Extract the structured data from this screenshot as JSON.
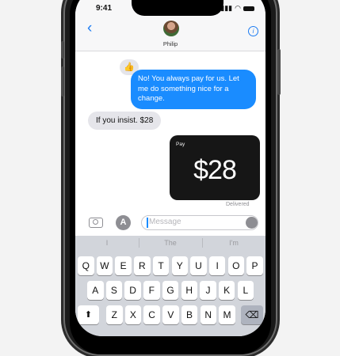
{
  "status_bar": {
    "time": "9:41"
  },
  "header": {
    "contact_name": "Philip",
    "back_glyph": "‹",
    "info_glyph": "i"
  },
  "messages": {
    "tapback_glyph": "👍",
    "outgoing": "No! You always pay for us. Let me do something nice for a change.",
    "incoming": "If you insist. $28",
    "payment": {
      "label": "Pay",
      "amount": "$28"
    },
    "delivered": "Delivered"
  },
  "composer": {
    "placeholder": "Message"
  },
  "keyboard": {
    "suggestions": [
      "I",
      "The",
      "I'm"
    ],
    "row1": [
      "Q",
      "W",
      "E",
      "R",
      "T",
      "Y",
      "U",
      "I",
      "O",
      "P"
    ],
    "row2": [
      "A",
      "S",
      "D",
      "F",
      "G",
      "H",
      "J",
      "K",
      "L"
    ],
    "row3": [
      "Z",
      "X",
      "C",
      "V",
      "B",
      "N",
      "M"
    ],
    "shift_glyph": "⬆",
    "delete_glyph": "⌫"
  },
  "colors": {
    "accent": "#1a8cff",
    "bubble_in": "#e5e5ea",
    "pay_card": "#161616",
    "background": "#f3f3f3"
  },
  "icons": [
    "back-chevron-icon",
    "info-icon",
    "camera-icon",
    "app-store-icon",
    "mic-icon",
    "thumbs-up-icon",
    "apple-logo-icon",
    "shift-icon",
    "delete-icon"
  ]
}
